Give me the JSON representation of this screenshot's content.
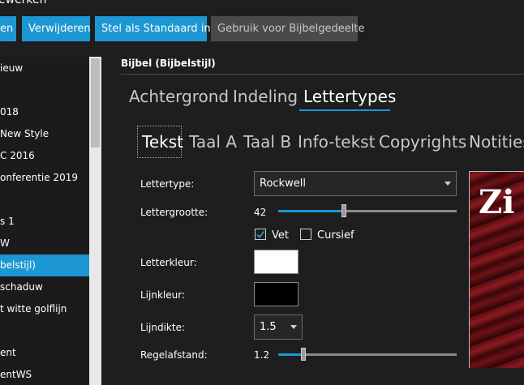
{
  "window": {
    "title_fragment": "ewerken"
  },
  "toolbar": {
    "buttons": [
      {
        "label": "en"
      },
      {
        "label": "Verwijderen"
      },
      {
        "label": "Stel als Standaard in"
      },
      {
        "label": "Gebruik voor Bijbelgedeelte"
      }
    ]
  },
  "sidebar": {
    "items": [
      {
        "label": "ieuw"
      },
      {
        "label": ""
      },
      {
        "label": "018"
      },
      {
        "label": "New Style"
      },
      {
        "label": "C 2016"
      },
      {
        "label": "onferentie 2019"
      },
      {
        "label": ""
      },
      {
        "label": "s 1"
      },
      {
        "label": "W"
      },
      {
        "label": "belstijl)"
      },
      {
        "label": "schaduw"
      },
      {
        "label": "t witte golflijn"
      },
      {
        "label": ""
      },
      {
        "label": "ent"
      },
      {
        "label": "entWS"
      }
    ],
    "selected_index": 9
  },
  "section": {
    "title": "Bijbel (Bijbelstijl)"
  },
  "tabs": [
    "Achtergrond",
    "Indeling",
    "Lettertypes"
  ],
  "active_tab": 2,
  "subtabs": [
    "Tekst",
    "Taal A",
    "Taal B",
    "Info-tekst",
    "Copyrights",
    "Notities"
  ],
  "active_subtab": 0,
  "form": {
    "font_label": "Lettertype:",
    "font_value": "Rockwell",
    "size_label": "Lettergrootte:",
    "size_value": "42",
    "size_slider_fraction": 0.37,
    "bold_label": "Vet",
    "bold_checked": true,
    "italic_label": "Cursief",
    "italic_checked": false,
    "color_label": "Letterkleur:",
    "color_value": "#ffffff",
    "line_color_label": "Lijnkleur:",
    "line_color_value": "#000000",
    "line_width_label": "Lijndikte:",
    "line_width_value": "1.5",
    "spacing_label": "Regelafstand:",
    "spacing_value": "1.2",
    "spacing_slider_fraction": 0.14
  },
  "preview": {
    "text": "Zi"
  },
  "colors": {
    "accent": "#1c97d3",
    "background": "#1e1e1e",
    "disabled_button": "#4a4a4a"
  },
  "icons": {
    "dropdown": "chevron-down-icon",
    "check": "check-icon"
  }
}
